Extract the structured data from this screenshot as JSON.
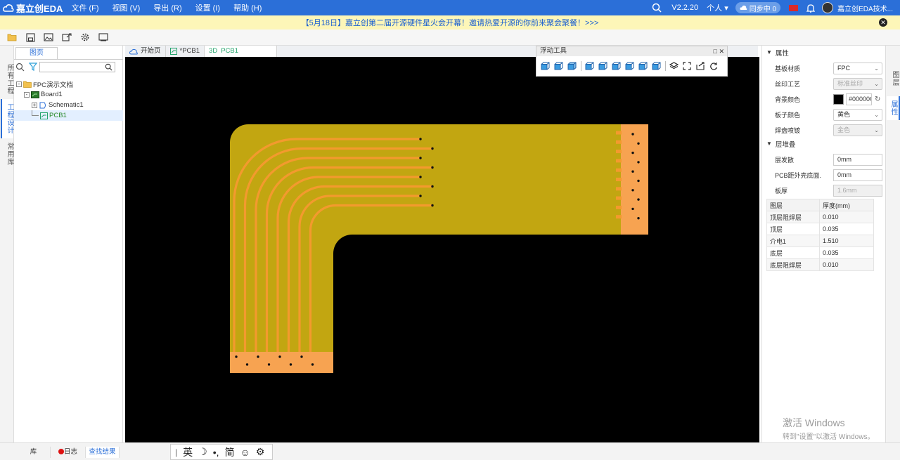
{
  "app": {
    "logo_text": "嘉立创EDA",
    "version": "V2.2.20",
    "personal": "个人",
    "sync": "同步中 0",
    "user": "嘉立创EDA技术..."
  },
  "menu": [
    "文件 (F)",
    "视图 (V)",
    "导出 (R)",
    "设置 (I)",
    "帮助 (H)"
  ],
  "notice": {
    "text": "【5月18日】嘉立创第二届开源硬件星火会开幕！邀请热爱开源的你前来聚会聚餐！>>>"
  },
  "toolbar_icons": [
    "folder-icon",
    "save-icon",
    "image-icon",
    "share-icon",
    "settings-icon",
    "display-icon"
  ],
  "left_tabs": [
    "所有工程",
    "工程设计",
    "常用库"
  ],
  "project_panel": {
    "tab": "图页",
    "tree": [
      {
        "label": "FPC演示文档",
        "level": 0,
        "icon": "folder-icon",
        "expander": "-"
      },
      {
        "label": "Board1",
        "level": 1,
        "icon": "board-icon",
        "expander": "-"
      },
      {
        "label": "Schematic1",
        "level": 2,
        "icon": "schematic-icon",
        "expander": "+"
      },
      {
        "label": "PCB1",
        "level": 2,
        "icon": "pcb-icon",
        "expander": "",
        "selected": true
      }
    ]
  },
  "doc_tabs": [
    {
      "label": "开始页",
      "icon": "home-cloud-icon"
    },
    {
      "label": "*PCB1",
      "icon": "pcb-icon"
    },
    {
      "label": "PCB1",
      "prefix": "3D",
      "active": true
    }
  ],
  "floating_tools": {
    "title": "浮动工具"
  },
  "properties": {
    "section_title": "属性",
    "rows": [
      {
        "label": "基板材质",
        "value": "FPC",
        "type": "select"
      },
      {
        "label": "丝印工艺",
        "value": "标准丝印",
        "type": "select",
        "disabled": true
      },
      {
        "label": "背景颜色",
        "value": "#00000C",
        "type": "color"
      },
      {
        "label": "板子颜色",
        "value": "黄色",
        "type": "select"
      },
      {
        "label": "焊盘喷镀",
        "value": "金色",
        "type": "select",
        "disabled": true
      }
    ]
  },
  "stackup": {
    "section_title": "层堆叠",
    "rows": [
      {
        "label": "层发散",
        "value": "0mm"
      },
      {
        "label": "PCB距外壳底面...",
        "value": "0mm"
      },
      {
        "label": "板厚",
        "value": "1.6mm",
        "disabled": true
      }
    ],
    "table_headers": [
      "图层",
      "厚度(mm)"
    ],
    "table": [
      [
        "顶层阻焊层",
        "0.010"
      ],
      [
        "顶层",
        "0.035"
      ],
      [
        "介电1",
        "1.510"
      ],
      [
        "底层",
        "0.035"
      ],
      [
        "底层阻焊层",
        "0.010"
      ]
    ]
  },
  "right_tabs": [
    "图层",
    "属性"
  ],
  "bottom_tabs": [
    "库",
    "日志",
    "查找结果"
  ],
  "ime": [
    "英",
    "☽",
    "•,",
    "简",
    "☺",
    "⚙"
  ],
  "watermark": {
    "line1": "激活 Windows",
    "line2": "转到\"设置\"以激活 Windows。"
  },
  "colors": {
    "accent": "#2b6fd8",
    "board": "#c2a611",
    "trace": "#f39a2e",
    "pad": "#f7a351",
    "canvas": "#000000",
    "notice_bg": "#fdf6b8"
  }
}
